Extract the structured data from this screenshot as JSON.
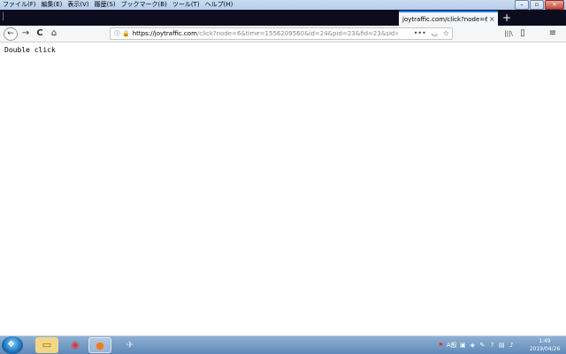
{
  "menu": {
    "items": [
      "ファイル(F)",
      "編集(E)",
      "表示(V)",
      "履歴(S)",
      "ブックマーク(B)",
      "ツール(T)",
      "ヘルプ(H)"
    ]
  },
  "tab": {
    "title": "joytraffic.com/click?node=6&ti",
    "close_glyph": "×",
    "new_tab_glyph": "+"
  },
  "nav": {
    "back_glyph": "←",
    "forward_glyph": "→",
    "reload_glyph": "C",
    "home_glyph": "⌂",
    "url_host": "https://joytraffic.com",
    "url_rest": "/click?node=6&time=1556209560&id=24&pid=23&fid=23&sid=13",
    "more_glyph": "•••",
    "library_glyph": "|||\\",
    "sidebar_glyph": "▯",
    "menu_glyph": "≡"
  },
  "page": {
    "body_text": "Double click"
  },
  "taskbar": {
    "time": "1:49",
    "date": "2019/04/26",
    "ime_label": "A般"
  },
  "colors": {
    "accent": "#0a84ff",
    "lock_green": "#12bc00",
    "tab_strip": "#0c0c1e",
    "taskbar": "#5f89b8"
  }
}
